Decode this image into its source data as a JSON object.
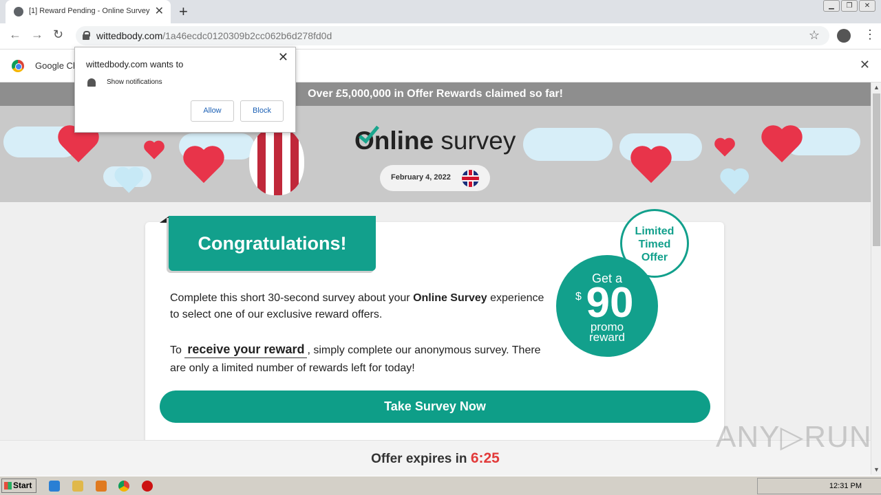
{
  "browser": {
    "tab_title": "[1] Reward Pending - Online Survey",
    "new_tab": "+",
    "tab_close": "✕",
    "url_domain": "wittedbody.com",
    "url_path": "/1a46ecdc0120309b2cc062b6d278fd0d",
    "infobar_text": "Google Ch",
    "win_buttons": [
      "▁",
      "❐",
      "✕"
    ]
  },
  "notification_popup": {
    "title": "wittedbody.com wants to",
    "permission": "Show notifications",
    "allow_label": "Allow",
    "block_label": "Block"
  },
  "page": {
    "top_banner": "Over £5,000,000 in Offer Rewards claimed so far!",
    "logo_bold": "Online",
    "logo_light": "survey",
    "date": "February 4, 2022",
    "congrats": "Congratulations!",
    "intro_1": "Complete this short 30-second survey about your",
    "intro_brand": "Online Survey",
    "intro_2": "experience to select one of our exclusive reward offers.",
    "p2_a": "To",
    "p2_u": "receive your reward",
    "p2_b": ", simply complete our anonymous survey. There are only a limited number of rewards left for today!",
    "cta": "Take Survey Now",
    "limited": [
      "Limited",
      "Timed",
      "Offer"
    ],
    "promo_get": "Get a",
    "promo_dollar": "$",
    "promo_amount": "90",
    "promo_word1": "promo",
    "promo_word2": "reward",
    "footer_text": "Offer expires in",
    "footer_time": "6:25"
  },
  "watermark": "ANY▷RUN",
  "taskbar": {
    "start_label": "Start",
    "clock": "12:31 PM"
  },
  "colors": {
    "brand_teal": "#12a08c",
    "timer_red": "#e23a3a",
    "banner_gray": "#8e8e8e"
  }
}
